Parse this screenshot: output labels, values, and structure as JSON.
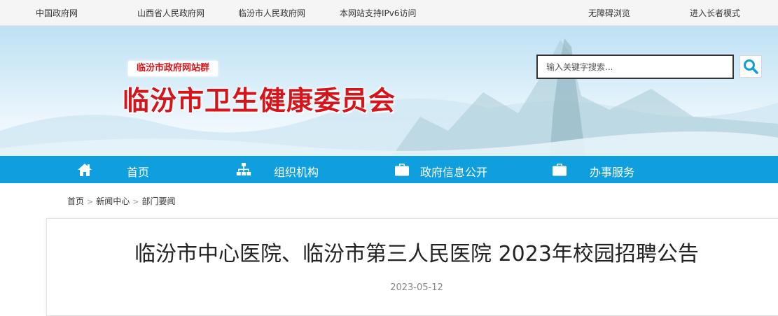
{
  "topbar": {
    "links": [
      "中国政府网",
      "山西省人民政府网",
      "临汾市人民政府网",
      "本网站支持IPv6访问",
      "无障碍浏览",
      "进入长者模式"
    ]
  },
  "header": {
    "site_group": "临汾市政府网站群",
    "site_title": "临汾市卫生健康委员会",
    "search_placeholder": "输入关键字搜索..."
  },
  "nav": {
    "items": [
      {
        "label": "首页",
        "icon": "home-icon"
      },
      {
        "label": "组织机构",
        "icon": "org-chart-icon"
      },
      {
        "label": "政府信息公开",
        "icon": "briefcase-icon"
      },
      {
        "label": "办事服务",
        "icon": "briefcase-icon"
      }
    ]
  },
  "breadcrumb": {
    "items": [
      "首页",
      "新闻中心",
      "部门要闻"
    ],
    "separator": ">"
  },
  "article": {
    "title": "临汾市中心医院、临汾市第三人民医院 2023年校园招聘公告",
    "date": "2023-05-12"
  },
  "colors": {
    "nav_bg": "#0f9ede",
    "title_red": "#d5141b"
  }
}
